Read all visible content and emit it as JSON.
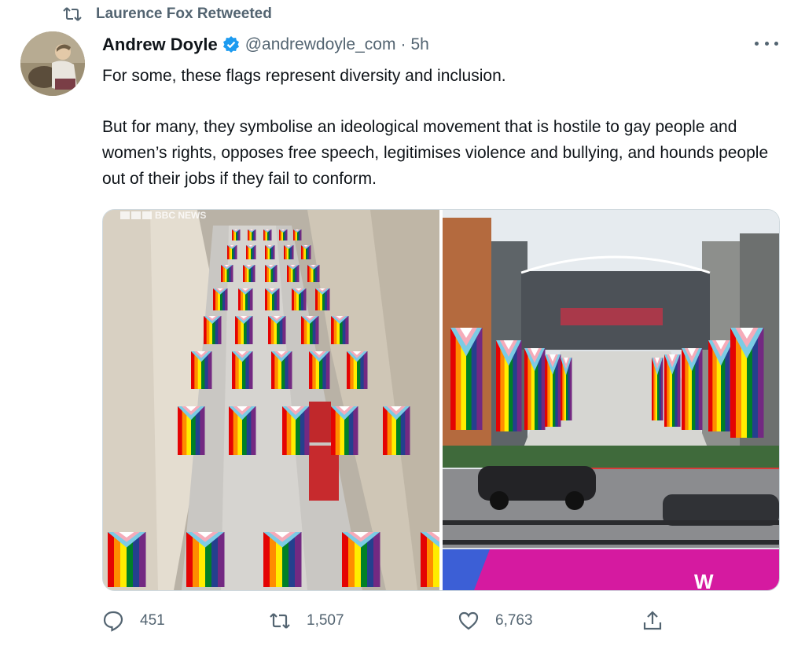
{
  "retweet_banner": {
    "text": "Laurence Fox Retweeted",
    "icon": "retweet-icon"
  },
  "tweet": {
    "author_name": "Andrew Doyle",
    "handle": "@andrewdoyle_com",
    "separator": "·",
    "time": "5h",
    "verified_icon": "verified-badge-icon",
    "text_paragraphs": [
      "For some, these flags represent diversity and inclusion.",
      "But for many, they symbolise an ideological movement that is hostile to gay people and women’s rights, opposes free speech, legitimises violence and bullying, and hounds people out of their jobs if they fail to conform."
    ],
    "media": {
      "left_watermark": "BBC NEWS",
      "right_overlay": "W"
    }
  },
  "actions": {
    "reply_count": "451",
    "retweet_count": "1,507",
    "like_count": "6,763",
    "icons": [
      "reply-icon",
      "retweet-icon",
      "like-icon",
      "share-icon"
    ]
  },
  "colors": {
    "text": "#0f1419",
    "secondary": "#536471",
    "verified": "#1d9bf0",
    "border": "#cfd9de"
  }
}
